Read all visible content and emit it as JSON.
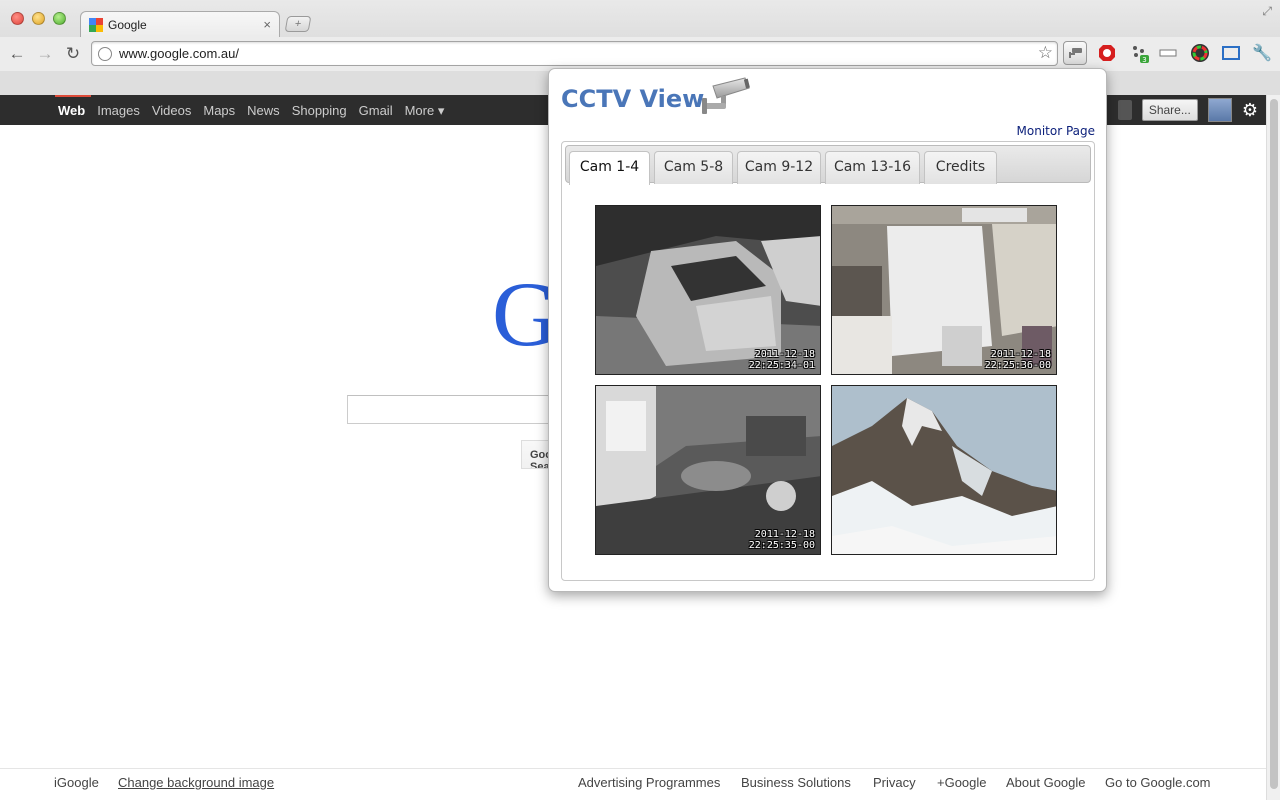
{
  "browser": {
    "tab_title": "Google",
    "tab_close": "×",
    "new_tab": "+",
    "url": "www.google.com.au/",
    "badge_count": "3"
  },
  "gbar": {
    "nav": [
      "Web",
      "Images",
      "Videos",
      "Maps",
      "News",
      "Shopping",
      "Gmail",
      "More ▾"
    ],
    "share_label": "Share..."
  },
  "google": {
    "logo_letter": "G",
    "search_button": "Google Search"
  },
  "footer": {
    "left": [
      "iGoogle",
      "Change background image"
    ],
    "right": [
      "Advertising Programmes",
      "Business Solutions",
      "Privacy",
      "+Google",
      "About Google",
      "Go to Google.com"
    ]
  },
  "popup": {
    "title": "CCTV View",
    "monitor_link": "Monitor Page",
    "tabs": [
      "Cam 1-4",
      "Cam 5-8",
      "Cam 9-12",
      "Cam 13-16",
      "Credits"
    ],
    "active_tab": "Cam 1-4",
    "cams": [
      {
        "date": "2011-12-18",
        "time": "22:25:34-01"
      },
      {
        "date": "2011-12-18",
        "time": "22:25:36-00"
      },
      {
        "date": "2011-12-18",
        "time": "22:25:35-00"
      },
      {
        "date": "",
        "time": ""
      }
    ]
  }
}
